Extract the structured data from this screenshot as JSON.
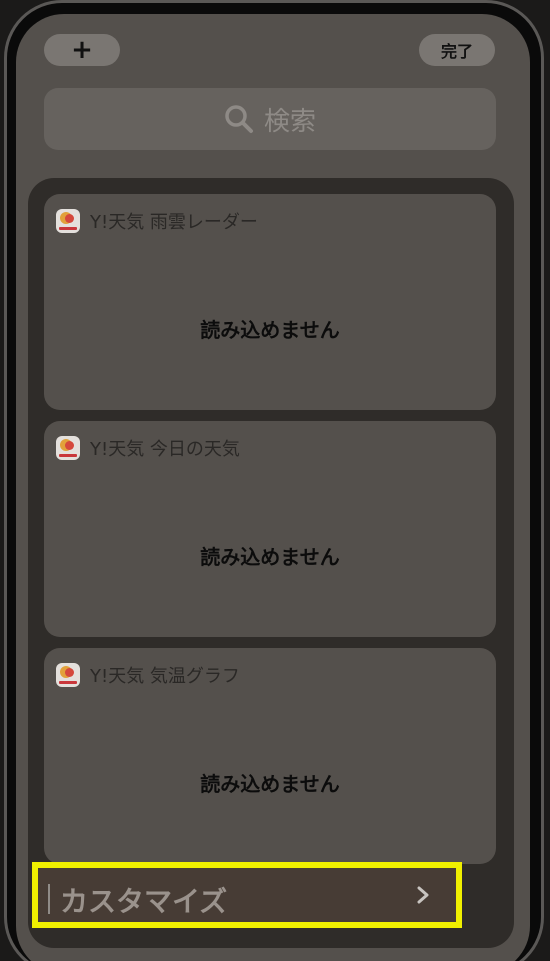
{
  "toolbar": {
    "add_label": "+",
    "done_label": "完了"
  },
  "search": {
    "placeholder": "検索",
    "icon": "search-icon"
  },
  "widgets": [
    {
      "title": "Y!天気 雨雲レーダー",
      "status": "読み込めません",
      "icon": "yahoo-weather-app-icon"
    },
    {
      "title": "Y!天気 今日の天気",
      "status": "読み込めません",
      "icon": "yahoo-weather-app-icon"
    },
    {
      "title": "Y!天気 気温グラフ",
      "status": "読み込めません",
      "icon": "yahoo-weather-app-icon"
    }
  ],
  "customize": {
    "label": "カスタマイズ",
    "icon": "chevron-right-icon"
  },
  "colors": {
    "highlight": "#f0f000",
    "screen_bg": "#54504c",
    "card_bg": "#54504c",
    "list_bg": "#2f2c29"
  }
}
